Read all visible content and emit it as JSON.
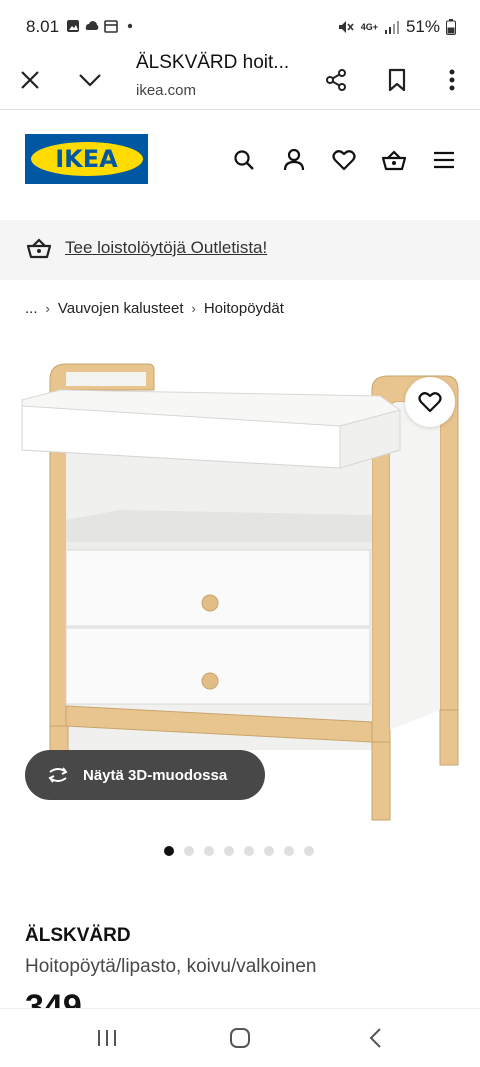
{
  "status_bar": {
    "time": "8.01",
    "network": "4G+",
    "battery": "51%"
  },
  "browser": {
    "title": "ÄLSKVÄRD hoit...",
    "url": "ikea.com"
  },
  "header": {
    "logo_text": "IKEA",
    "brand_colors": {
      "blue": "#0058a3",
      "yellow": "#ffdb00"
    },
    "icons": [
      "search-icon",
      "user-icon",
      "heart-icon",
      "basket-icon",
      "menu-icon"
    ]
  },
  "banner": {
    "text": "Tee loistolöytöjä Outletista!"
  },
  "breadcrumb": {
    "ellipsis": "...",
    "items": [
      "Vauvojen kalusteet",
      "Hoitopöydät"
    ]
  },
  "gallery": {
    "view_3d_label": "Näytä 3D-muodossa",
    "image_count": 8,
    "active_index": 0
  },
  "product": {
    "name": "ÄLSKVÄRD",
    "description": "Hoitopöytä/lipasto, koivu/valkoinen",
    "price": "349"
  }
}
